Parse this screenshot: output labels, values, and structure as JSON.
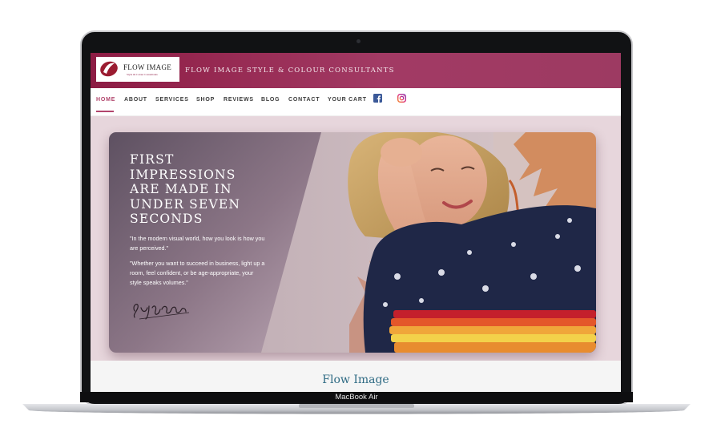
{
  "site": {
    "logo_text": "FLOW IMAGE",
    "logo_subtext": "Style & Colour Consultants",
    "title": "FLOW IMAGE STYLE & COLOUR CONSULTANTS",
    "brand_color": "#8d1c44"
  },
  "nav": {
    "items": [
      "HOME",
      "ABOUT",
      "SERVICES",
      "SHOP",
      "REVIEWS",
      "BLOG",
      "CONTACT",
      "YOUR CART"
    ],
    "active": "HOME",
    "social_icons": [
      "facebook-icon",
      "instagram-icon"
    ]
  },
  "hero": {
    "title": "FIRST IMPRESSIONS ARE MADE IN UNDER SEVEN SECONDS",
    "quote_1": "\"In the modern visual world, how you look is how you are perceived.\"",
    "quote_2": "\"Whether you want to succeed in business, light up a room, feel confident, or be age-appropriate, your style speaks volumes.\"",
    "signature": "Sujeiana"
  },
  "section": {
    "title": "Flow Image"
  },
  "device": {
    "label": "MacBook Air"
  }
}
